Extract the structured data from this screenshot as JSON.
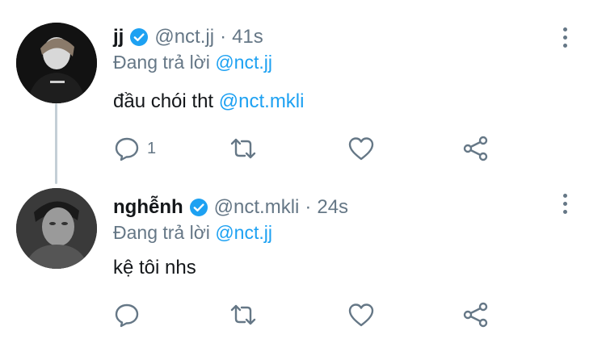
{
  "colors": {
    "accent": "#1da1f2",
    "muted": "#657786",
    "text": "#14171a",
    "thread_line": "#c4cfd6"
  },
  "tweets": [
    {
      "name": "jj",
      "handle": "@nct.jj",
      "separator": "·",
      "time": "41s",
      "reply_prefix": "Đang trả lời",
      "reply_to": "@nct.jj",
      "text": "đầu chói tht",
      "text_mention": "@nct.mkli",
      "reply_count": "1"
    },
    {
      "name": "nghễnh",
      "handle": "@nct.mkli",
      "separator": "·",
      "time": "24s",
      "reply_prefix": "Đang trả lời",
      "reply_to": "@nct.jj",
      "text": "kệ tôi nhs",
      "reply_count": ""
    }
  ],
  "icons": [
    "verified-icon",
    "more-icon",
    "reply-icon",
    "retweet-icon",
    "like-icon",
    "share-icon"
  ]
}
